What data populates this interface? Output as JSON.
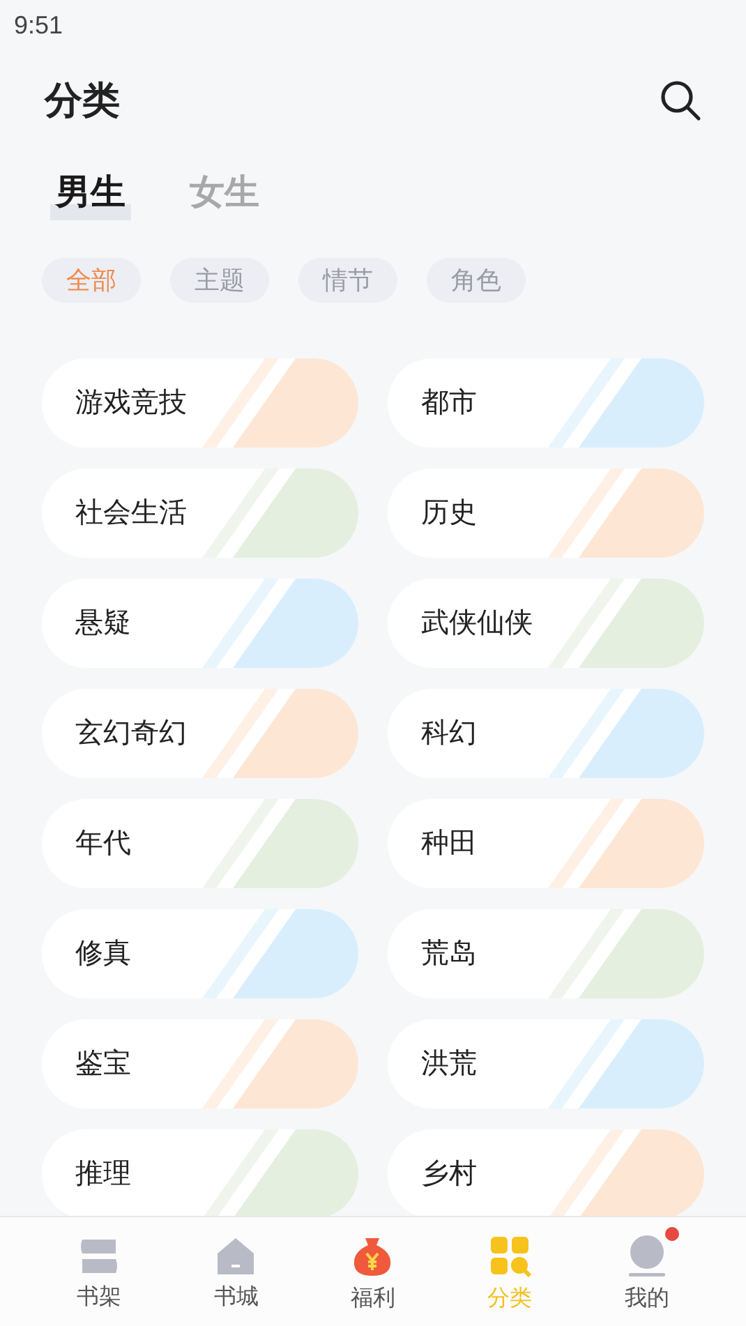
{
  "status_bar": {
    "time": "9:51"
  },
  "header": {
    "title": "分类"
  },
  "gender_tabs": [
    {
      "label": "男生",
      "selected": true
    },
    {
      "label": "女生",
      "selected": false
    }
  ],
  "filters": [
    {
      "label": "全部",
      "selected": true
    },
    {
      "label": "主题",
      "selected": false
    },
    {
      "label": "情节",
      "selected": false
    },
    {
      "label": "角色",
      "selected": false
    }
  ],
  "categories": [
    {
      "label": "游戏竞技",
      "color": "#fde6d4"
    },
    {
      "label": "都市",
      "color": "#d9eefc"
    },
    {
      "label": "社会生活",
      "color": "#e4efdf"
    },
    {
      "label": "历史",
      "color": "#fde6d4"
    },
    {
      "label": "悬疑",
      "color": "#d9eefc"
    },
    {
      "label": "武侠仙侠",
      "color": "#e4efdf"
    },
    {
      "label": "玄幻奇幻",
      "color": "#fde6d4"
    },
    {
      "label": "科幻",
      "color": "#d9eefc"
    },
    {
      "label": "年代",
      "color": "#e4efdf"
    },
    {
      "label": "种田",
      "color": "#fde6d4"
    },
    {
      "label": "修真",
      "color": "#d9eefc"
    },
    {
      "label": "荒岛",
      "color": "#e4efdf"
    },
    {
      "label": "鉴宝",
      "color": "#fde6d4"
    },
    {
      "label": "洪荒",
      "color": "#d9eefc"
    },
    {
      "label": "推理",
      "color": "#e4efdf"
    },
    {
      "label": "乡村",
      "color": "#fde6d4"
    }
  ],
  "nav": [
    {
      "kind": "shelf",
      "label": "书架",
      "selected": false,
      "badge": false
    },
    {
      "kind": "store",
      "label": "书城",
      "selected": false,
      "badge": false
    },
    {
      "kind": "bag",
      "label": "福利",
      "selected": false,
      "badge": false
    },
    {
      "kind": "grid",
      "label": "分类",
      "selected": true,
      "badge": false
    },
    {
      "kind": "profile",
      "label": "我的",
      "selected": false,
      "badge": true
    }
  ]
}
